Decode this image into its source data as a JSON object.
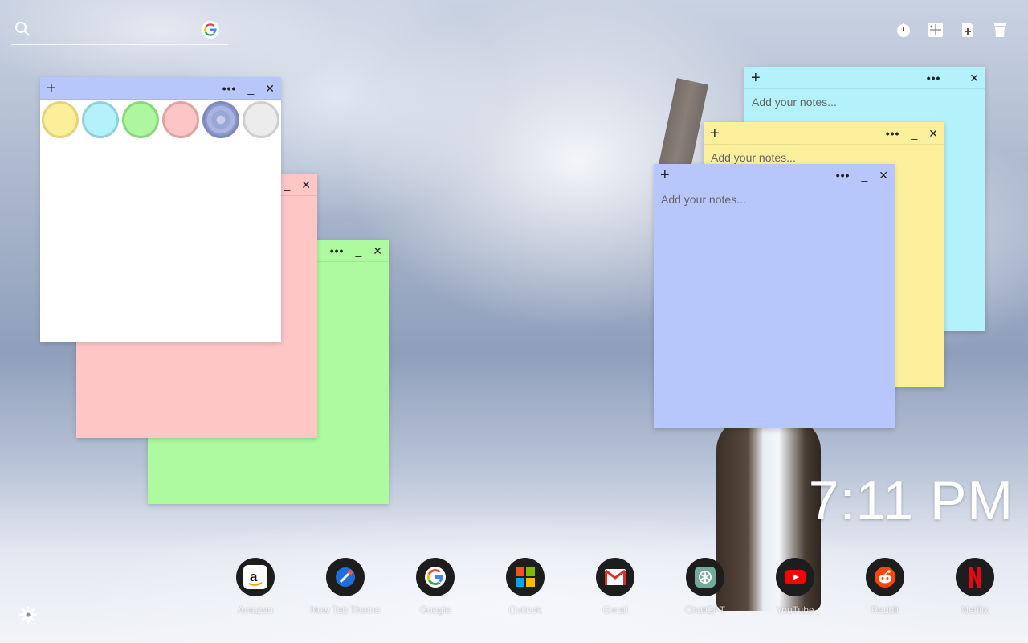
{
  "search": {
    "placeholder": ""
  },
  "top_actions": [
    {
      "icon": "timer-icon"
    },
    {
      "icon": "calculator-icon"
    },
    {
      "icon": "add-note-icon"
    },
    {
      "icon": "trash-icon"
    }
  ],
  "notes": {
    "placeholder": "Add your notes...",
    "add_glyph": "+",
    "more_glyph": "•••",
    "minimize_glyph": "_",
    "close_glyph": "✕"
  },
  "palette": {
    "colors": [
      "#fbef9a",
      "#b3f1fb",
      "#aef7a0",
      "#fcc6c6",
      "#9aa6d6",
      "#ececec"
    ]
  },
  "note_colors": {
    "blue": "#b8c7fb",
    "yellow": "#fdf09c",
    "cyan": "#b3f1fb",
    "pink": "#ffc6c6",
    "green": "#aefb9f",
    "white": "#ffffff"
  },
  "clock": {
    "time": "7:11 PM"
  },
  "dock": [
    {
      "label": "Amazon",
      "icon": "amazon-icon"
    },
    {
      "label": "New Tab Theme",
      "icon": "new-tab-theme-icon"
    },
    {
      "label": "Google",
      "icon": "google-icon"
    },
    {
      "label": "Outlook",
      "icon": "outlook-icon"
    },
    {
      "label": "Gmail",
      "icon": "gmail-icon"
    },
    {
      "label": "ChatGPT",
      "icon": "chatgpt-icon"
    },
    {
      "label": "YouTube",
      "icon": "youtube-icon"
    },
    {
      "label": "Reddit",
      "icon": "reddit-icon"
    },
    {
      "label": "Netflix",
      "icon": "netflix-icon"
    }
  ]
}
